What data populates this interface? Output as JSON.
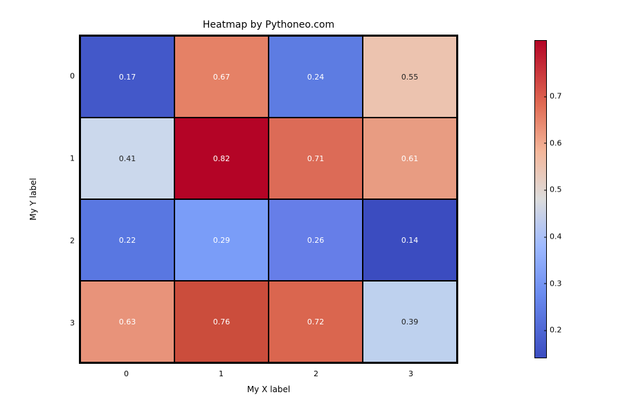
{
  "chart_data": {
    "type": "heatmap",
    "title": "Heatmap by Pythoneo.com",
    "xlabel": "My X label",
    "ylabel": "My Y label",
    "x_categories": [
      "0",
      "1",
      "2",
      "3"
    ],
    "y_categories": [
      "0",
      "1",
      "2",
      "3"
    ],
    "values": [
      [
        0.17,
        0.67,
        0.24,
        0.55
      ],
      [
        0.41,
        0.82,
        0.71,
        0.61
      ],
      [
        0.22,
        0.29,
        0.26,
        0.14
      ],
      [
        0.63,
        0.76,
        0.72,
        0.39
      ]
    ],
    "value_labels": [
      [
        "0.17",
        "0.67",
        "0.24",
        "0.55"
      ],
      [
        "0.41",
        "0.82",
        "0.71",
        "0.61"
      ],
      [
        "0.22",
        "0.29",
        "0.26",
        "0.14"
      ],
      [
        "0.63",
        "0.76",
        "0.72",
        "0.39"
      ]
    ],
    "vmin": 0.14,
    "vmax": 0.82,
    "colormap": "coolwarm",
    "colorbar_ticks": [
      "0.2",
      "0.3",
      "0.4",
      "0.5",
      "0.6",
      "0.7"
    ],
    "colorbar_tick_values": [
      0.2,
      0.3,
      0.4,
      0.5,
      0.6,
      0.7
    ]
  },
  "cell_colors": [
    [
      "#4358c9",
      "#e58166",
      "#5d7ce2",
      "#ecc3af"
    ],
    [
      "#cbd8ec",
      "#b40426",
      "#dc6b57",
      "#e89c82"
    ],
    [
      "#5977e1",
      "#7a9df8",
      "#667ee8",
      "#3b4cc0"
    ],
    [
      "#e8937a",
      "#cb4d3c",
      "#da664f",
      "#bed1ee"
    ]
  ],
  "cell_textdark": [
    [
      false,
      false,
      false,
      true
    ],
    [
      true,
      false,
      false,
      false
    ],
    [
      false,
      false,
      false,
      false
    ],
    [
      false,
      false,
      false,
      true
    ]
  ]
}
